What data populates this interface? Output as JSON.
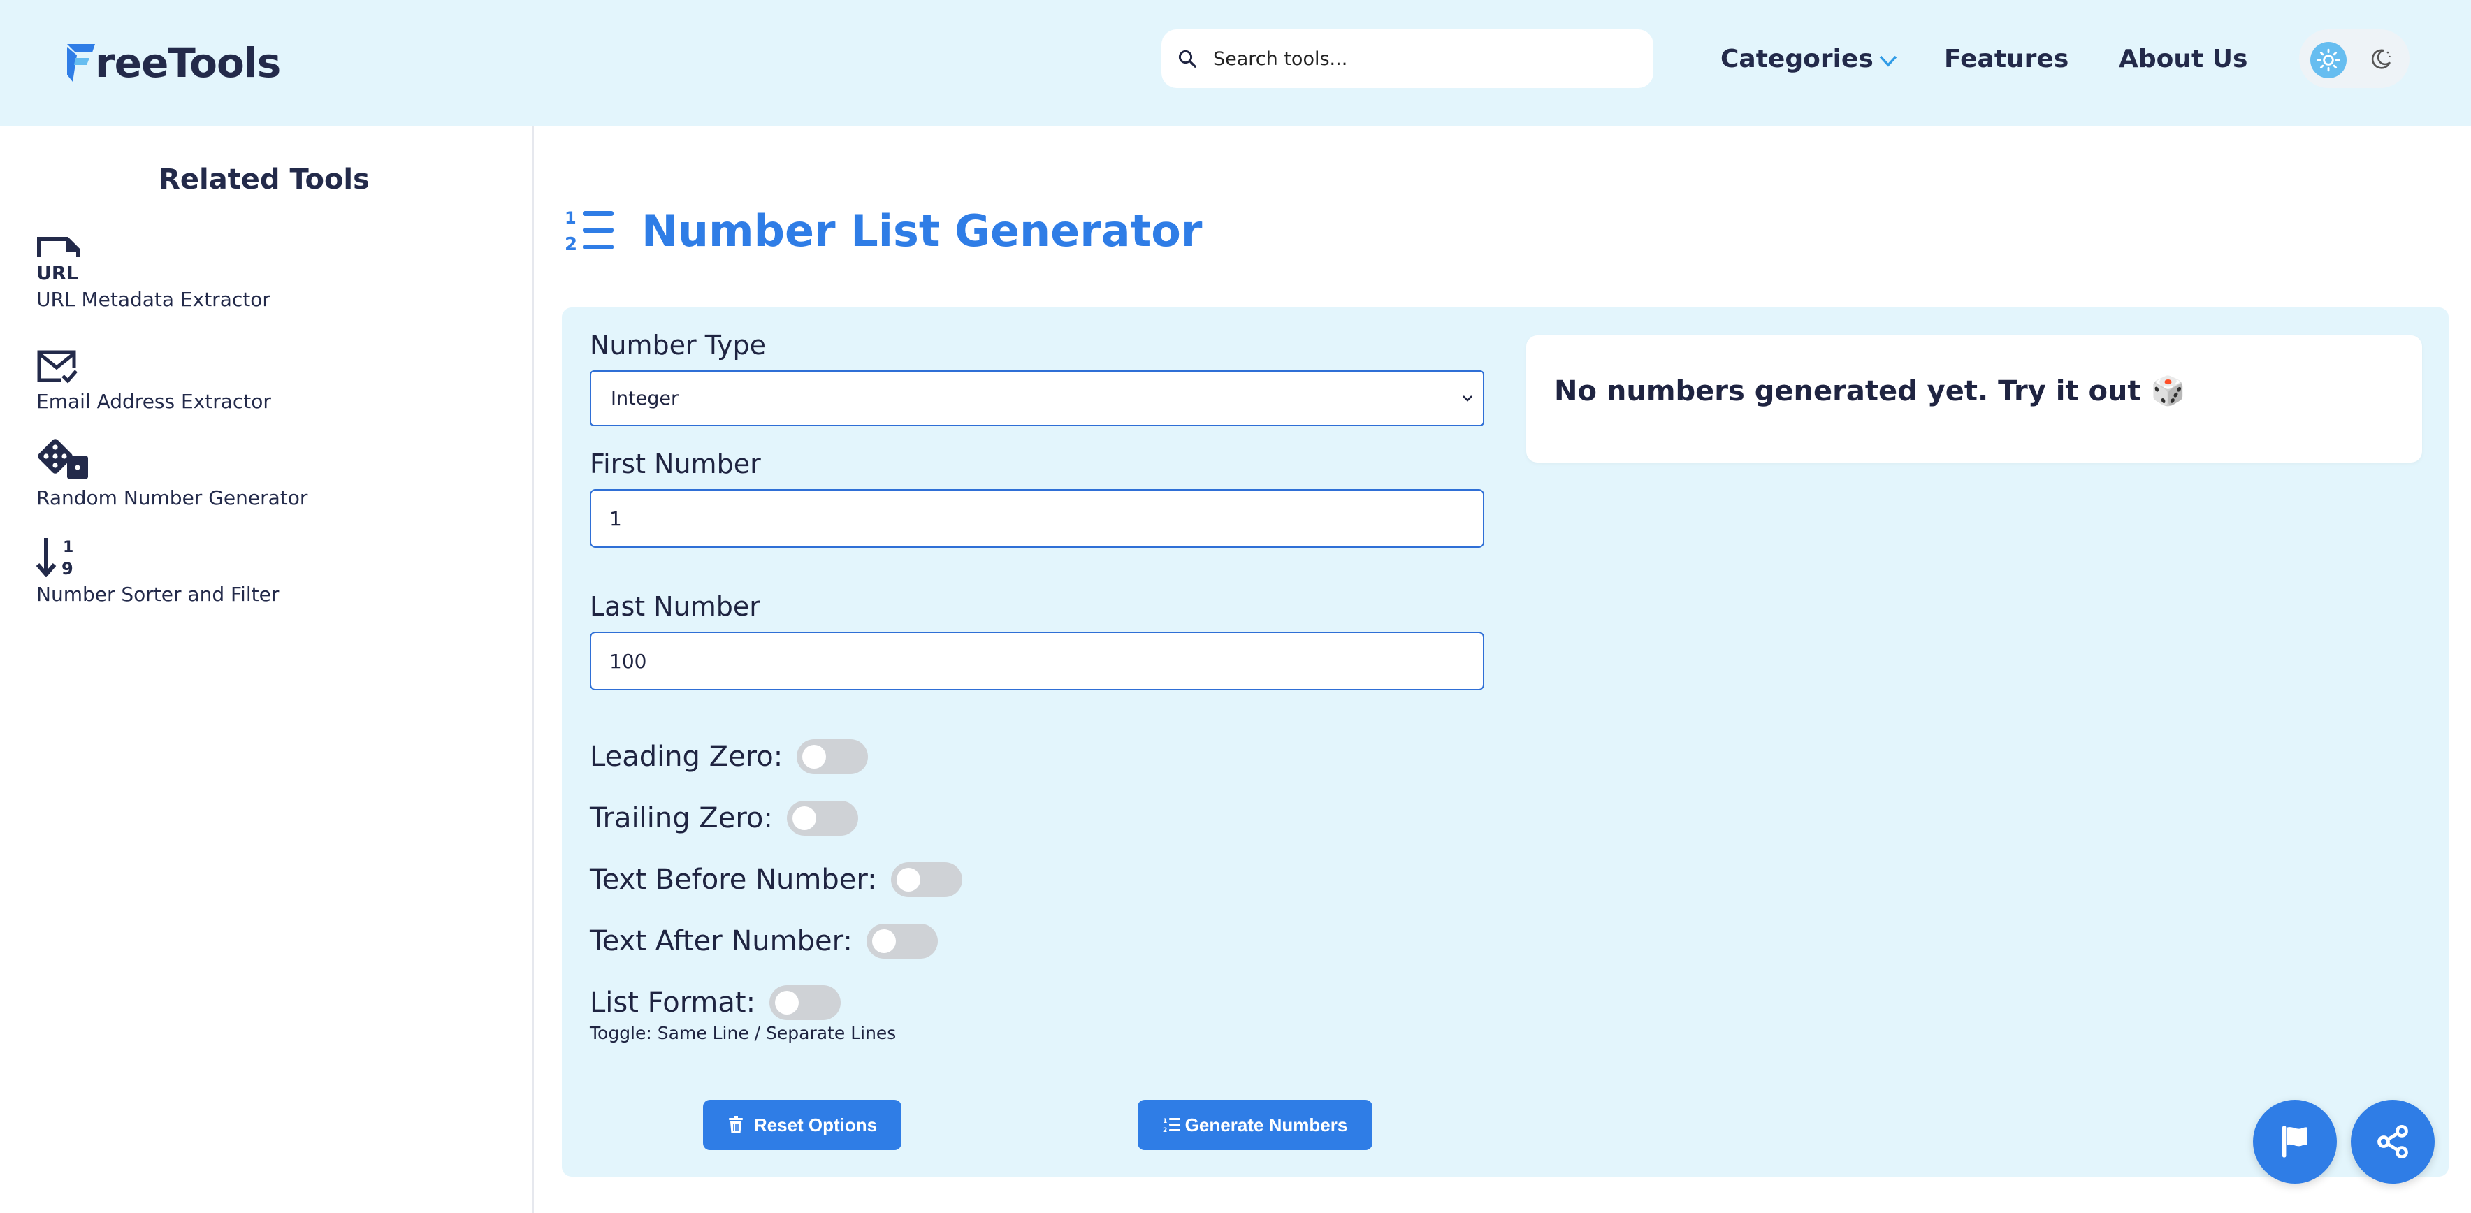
{
  "header": {
    "logo_text": "reeTools",
    "search_placeholder": "Search tools...",
    "nav": {
      "categories": "Categories",
      "features": "Features",
      "about": "About Us"
    },
    "theme_icons": [
      "sun-icon",
      "moon-icon"
    ]
  },
  "sidebar": {
    "title": "Related Tools",
    "items": [
      {
        "label": "URL Metadata Extractor",
        "icon": "url-file-icon"
      },
      {
        "label": "Email Address Extractor",
        "icon": "envelope-check-icon"
      },
      {
        "label": "Random Number Generator",
        "icon": "dice-icon"
      },
      {
        "label": "Number Sorter and Filter",
        "icon": "sort-numeric-icon"
      }
    ]
  },
  "main": {
    "title": "Number List Generator",
    "title_icon": "list-ol-icon",
    "form": {
      "number_type_label": "Number Type",
      "number_type_value": "Integer",
      "first_number_label": "First Number",
      "first_number_value": "1",
      "last_number_label": "Last Number",
      "last_number_value": "100",
      "toggles": [
        {
          "label": "Leading Zero:",
          "on": false
        },
        {
          "label": "Trailing Zero:",
          "on": false
        },
        {
          "label": "Text Before Number:",
          "on": false
        },
        {
          "label": "Text After Number:",
          "on": false
        },
        {
          "label": "List Format:",
          "on": false
        }
      ],
      "list_format_hint": "Toggle: Same Line / Separate Lines",
      "reset_label": "Reset Options",
      "generate_label": "Generate Numbers"
    },
    "output_text": "No numbers generated yet. Try it out 🎲"
  },
  "colors": {
    "accent": "#2f7de6",
    "header_bg": "#e3f5fc",
    "text": "#1f2441"
  }
}
